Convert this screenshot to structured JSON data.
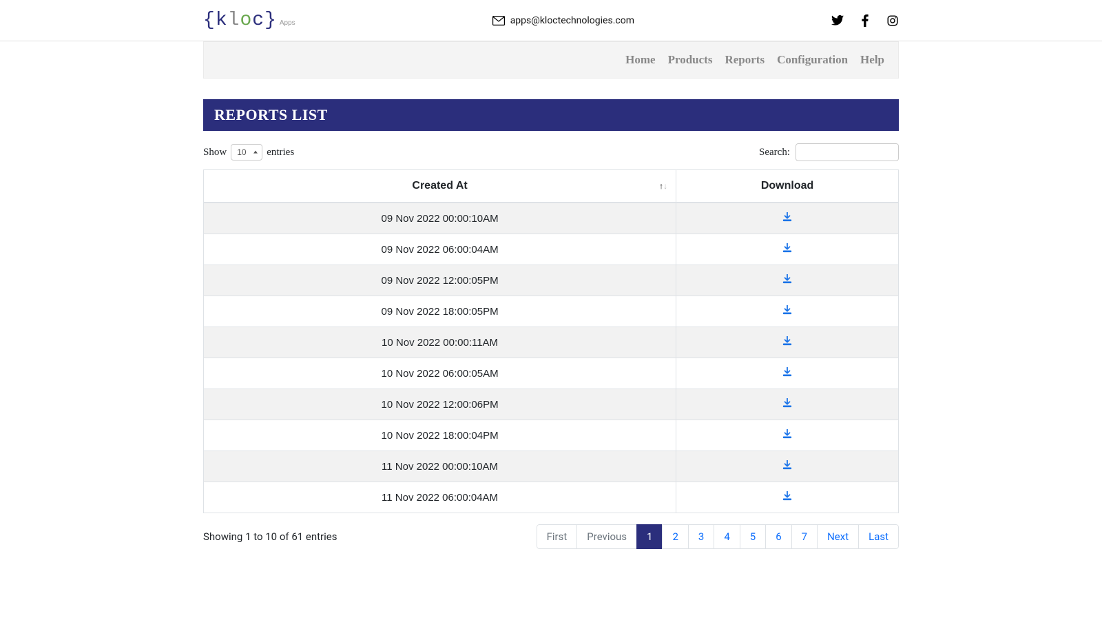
{
  "header": {
    "email": "apps@kloctechnologies.com",
    "logo_apps": "Apps"
  },
  "nav": {
    "items": [
      "Home",
      "Products",
      "Reports",
      "Configuration",
      "Help"
    ]
  },
  "page": {
    "title": "REPORTS LIST"
  },
  "controls": {
    "show_label_left": "Show",
    "show_label_right": "entries",
    "page_size": "10",
    "search_label": "Search:"
  },
  "table": {
    "columns": [
      "Created At",
      "Download"
    ],
    "rows": [
      {
        "created_at": "09 Nov 2022 00:00:10AM"
      },
      {
        "created_at": "09 Nov 2022 06:00:04AM"
      },
      {
        "created_at": "09 Nov 2022 12:00:05PM"
      },
      {
        "created_at": "09 Nov 2022 18:00:05PM"
      },
      {
        "created_at": "10 Nov 2022 00:00:11AM"
      },
      {
        "created_at": "10 Nov 2022 06:00:05AM"
      },
      {
        "created_at": "10 Nov 2022 12:00:06PM"
      },
      {
        "created_at": "10 Nov 2022 18:00:04PM"
      },
      {
        "created_at": "11 Nov 2022 00:00:10AM"
      },
      {
        "created_at": "11 Nov 2022 06:00:04AM"
      }
    ]
  },
  "footer": {
    "info": "Showing 1 to 10 of 61 entries",
    "pages": {
      "first": "First",
      "prev": "Previous",
      "next": "Next",
      "last": "Last",
      "numbers": [
        "1",
        "2",
        "3",
        "4",
        "5",
        "6",
        "7"
      ],
      "active_index": 0
    }
  }
}
